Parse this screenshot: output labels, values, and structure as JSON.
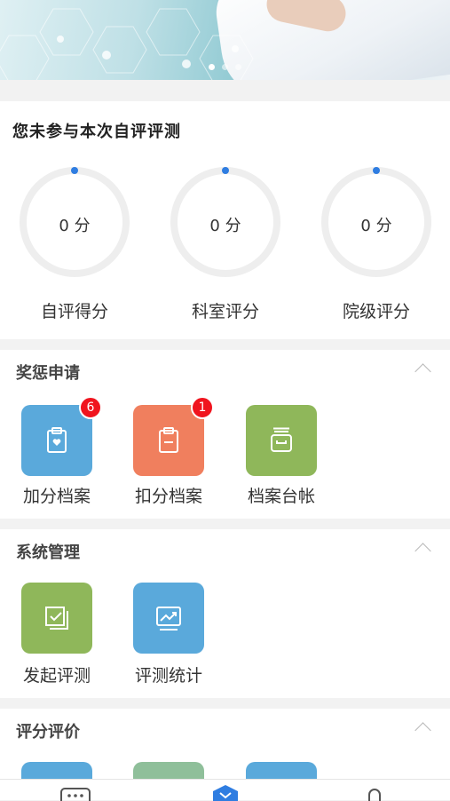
{
  "banner": {
    "slide_count": 3,
    "active_slide": 1
  },
  "self_eval": {
    "title": "您未参与本次自评评测",
    "gauges": [
      {
        "value": "0 分",
        "label": "自评得分",
        "score": 0
      },
      {
        "value": "0 分",
        "label": "科室评分",
        "score": 0
      },
      {
        "value": "0 分",
        "label": "院级评分",
        "score": 0
      }
    ],
    "ring_color": "#eeeeee",
    "indicator_color": "#2f7de1"
  },
  "rewards": {
    "title": "奖惩申请",
    "items": [
      {
        "label": "加分档案",
        "badge": "6",
        "color": "#5aa9db",
        "icon": "clipboard-heart-icon"
      },
      {
        "label": "扣分档案",
        "badge": "1",
        "color": "#f07f5e",
        "icon": "clipboard-minus-icon"
      },
      {
        "label": "档案台帐",
        "badge": "",
        "color": "#8fb75a",
        "icon": "archive-box-icon"
      }
    ]
  },
  "system": {
    "title": "系统管理",
    "items": [
      {
        "label": "发起评测",
        "color": "#8fb75a",
        "icon": "checklist-icon"
      },
      {
        "label": "评测统计",
        "color": "#5aa9db",
        "icon": "chart-icon"
      }
    ]
  },
  "rating": {
    "title": "评分评价",
    "items": [
      {
        "color": "#5aa9db"
      },
      {
        "color": "#8fbf9a"
      },
      {
        "color": "#5aa9db"
      }
    ]
  },
  "bottom_nav": {
    "items": [
      {
        "icon": "message-icon"
      },
      {
        "icon": "home-icon"
      },
      {
        "icon": "bell-icon"
      }
    ],
    "active_color": "#2f7de1"
  }
}
